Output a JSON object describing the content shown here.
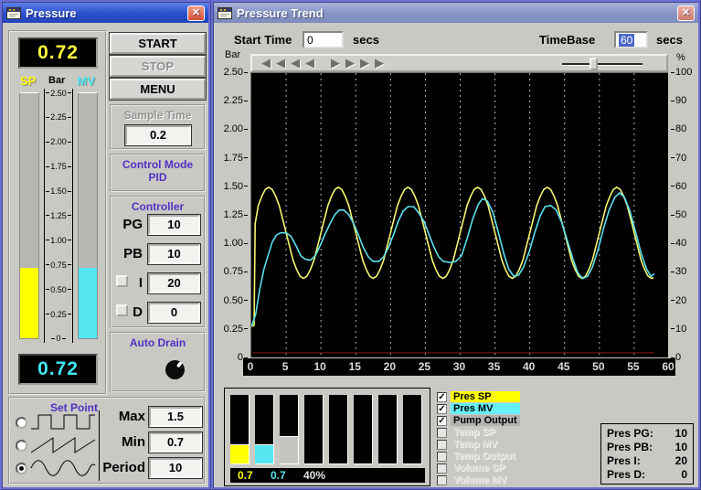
{
  "icons": {
    "check_glyph": "✓",
    "close_glyph": "✕",
    "left_arrow": "◀",
    "right_arrow": "▶"
  },
  "colors": {
    "sp_yellow": "#ffff00",
    "mv_cyan": "#55e6f2",
    "pump_gray": "#c4c4c0",
    "pump_trace": "#7a1414",
    "label_purple": "#5230c4",
    "titlebar_active": "#2a50cc",
    "titlebar_inactive": "#8694c6",
    "chart_bg": "#000000"
  },
  "pressure_window": {
    "title": "Pressure",
    "sp_display": "0.72",
    "mv_display": "0.72",
    "gauge": {
      "sp_label": "SP",
      "unit": "Bar",
      "mv_label": "MV",
      "ticks": [
        "2.50",
        "2.25",
        "2.00",
        "1.75",
        "1.50",
        "1.25",
        "1.00",
        "0.75",
        "0.50",
        "0.25",
        "0"
      ],
      "sp_value": 0.72,
      "mv_value": 0.72,
      "scale_max": 2.5
    },
    "buttons": [
      {
        "label": "START",
        "enabled": true
      },
      {
        "label": "STOP",
        "enabled": false
      },
      {
        "label": "MENU",
        "enabled": true
      }
    ],
    "sample_time": {
      "label": "Sample Time",
      "value": "0.2"
    },
    "control_mode": {
      "line1": "Control Mode",
      "line2": "PID"
    },
    "controller": {
      "title": "Controller",
      "rows": [
        {
          "label": "PG",
          "value": "10",
          "has_checkbox": false,
          "checked": false
        },
        {
          "label": "PB",
          "value": "10",
          "has_checkbox": false,
          "checked": false
        },
        {
          "label": "I",
          "value": "20",
          "has_checkbox": true,
          "checked": false
        },
        {
          "label": "D",
          "value": "0",
          "has_checkbox": true,
          "checked": false
        }
      ]
    },
    "auto_drain": {
      "label": "Auto Drain"
    },
    "set_point": {
      "title": "Set Point",
      "waveforms": [
        "square",
        "sawtooth",
        "sine"
      ],
      "selected_waveform": "sine",
      "rows": [
        {
          "label": "Max",
          "value": "1.5"
        },
        {
          "label": "Min",
          "value": "0.7"
        },
        {
          "label": "Period",
          "value": "10"
        }
      ]
    }
  },
  "trend_window": {
    "title": "Pressure Trend",
    "start_time": {
      "label": "Start Time",
      "value": "0",
      "unit": "secs"
    },
    "timebase": {
      "label": "TimeBase",
      "value": "60",
      "unit": "secs",
      "selected": true
    },
    "axis_units": {
      "left": "Bar",
      "right": "%"
    },
    "legend": [
      {
        "label": "Pres SP",
        "checked": true,
        "enabled": true,
        "color": "#ffff00"
      },
      {
        "label": "Pres MV",
        "checked": true,
        "enabled": true,
        "color": "#66f0f8"
      },
      {
        "label": "Pump Output",
        "checked": true,
        "enabled": true,
        "color": "#b2b2ae"
      },
      {
        "label": "Temp SP",
        "checked": false,
        "enabled": false,
        "color": ""
      },
      {
        "label": "Temp MV",
        "checked": false,
        "enabled": false,
        "color": ""
      },
      {
        "label": "Temp Output",
        "checked": false,
        "enabled": false,
        "color": ""
      },
      {
        "label": "Volume SP",
        "checked": false,
        "enabled": false,
        "color": ""
      },
      {
        "label": "Volume MV",
        "checked": false,
        "enabled": false,
        "color": ""
      }
    ],
    "pid_info": [
      {
        "label": "Pres PG:",
        "value": "10"
      },
      {
        "label": "Pres PB:",
        "value": "10"
      },
      {
        "label": "Pres I:",
        "value": "20"
      },
      {
        "label": "Pres D:",
        "value": "0"
      }
    ],
    "bar_gauges": {
      "count": 8,
      "fills": [
        {
          "fraction": 0.28,
          "color": "#ffff00"
        },
        {
          "fraction": 0.28,
          "color": "#55e6f2"
        },
        {
          "fraction": 0.4,
          "color": "#c4c4c0"
        },
        null,
        null,
        null,
        null,
        null
      ],
      "readout": [
        {
          "text": "0.7",
          "color": "#ffff00"
        },
        {
          "text": "0.7",
          "color": "#55e6f2"
        },
        {
          "text": "40%",
          "color": "#e0e0e0"
        }
      ]
    }
  },
  "chart_data": {
    "type": "line",
    "title": "",
    "xlabel": "secs",
    "xlim": [
      0,
      60
    ],
    "ylim_left": [
      0,
      2.5
    ],
    "ylim_right": [
      0,
      100
    ],
    "x_ticks": [
      0,
      5,
      10,
      15,
      20,
      25,
      30,
      35,
      40,
      45,
      50,
      55,
      60
    ],
    "y_left_ticks": [
      "2.50",
      "2.25",
      "2.00",
      "1.75",
      "1.50",
      "1.25",
      "1.00",
      "0.75",
      "0.50",
      "0.25",
      "0"
    ],
    "y_right_ticks": [
      "100",
      "90",
      "80",
      "70",
      "60",
      "50",
      "40",
      "30",
      "20",
      "10",
      "0"
    ],
    "grid": {
      "vertical_every": 5,
      "style": "dashed",
      "color": "#b4b4b4"
    },
    "legend_position": "below-right",
    "series": [
      {
        "name": "Pres SP",
        "color": "#f6f670",
        "width": 1.6,
        "points": [
          [
            0,
            0.28
          ],
          [
            0.4,
            0.29
          ],
          [
            0.55,
            1.18
          ],
          [
            1,
            1.34
          ],
          [
            1.5,
            1.42
          ],
          [
            2,
            1.48
          ],
          [
            2.5,
            1.5
          ],
          [
            3,
            1.48
          ],
          [
            3.5,
            1.42
          ],
          [
            4,
            1.34
          ],
          [
            4.5,
            1.22
          ],
          [
            5,
            1.1
          ],
          [
            5.5,
            0.98
          ],
          [
            6,
            0.86
          ],
          [
            6.5,
            0.78
          ],
          [
            7,
            0.72
          ],
          [
            7.5,
            0.7
          ],
          [
            8,
            0.72
          ],
          [
            8.5,
            0.78
          ],
          [
            9,
            0.86
          ],
          [
            9.5,
            0.98
          ],
          [
            10,
            1.1
          ],
          [
            10.5,
            1.22
          ],
          [
            11,
            1.34
          ],
          [
            11.5,
            1.42
          ],
          [
            12,
            1.48
          ],
          [
            12.5,
            1.5
          ],
          [
            13,
            1.48
          ],
          [
            13.5,
            1.42
          ],
          [
            14,
            1.34
          ],
          [
            14.5,
            1.22
          ],
          [
            15,
            1.1
          ],
          [
            15.5,
            0.98
          ],
          [
            16,
            0.86
          ],
          [
            16.5,
            0.78
          ],
          [
            17,
            0.72
          ],
          [
            17.5,
            0.7
          ],
          [
            18,
            0.72
          ],
          [
            18.5,
            0.78
          ],
          [
            19,
            0.86
          ],
          [
            19.5,
            0.98
          ],
          [
            20,
            1.1
          ],
          [
            20.5,
            1.22
          ],
          [
            21,
            1.34
          ],
          [
            21.5,
            1.42
          ],
          [
            22,
            1.48
          ],
          [
            22.5,
            1.5
          ],
          [
            23,
            1.48
          ],
          [
            23.5,
            1.42
          ],
          [
            24,
            1.34
          ],
          [
            24.5,
            1.22
          ],
          [
            25,
            1.1
          ],
          [
            25.5,
            0.98
          ],
          [
            26,
            0.86
          ],
          [
            26.5,
            0.78
          ],
          [
            27,
            0.72
          ],
          [
            27.5,
            0.7
          ],
          [
            28,
            0.72
          ],
          [
            28.5,
            0.78
          ],
          [
            29,
            0.86
          ],
          [
            29.5,
            0.98
          ],
          [
            30,
            1.1
          ],
          [
            30.5,
            1.22
          ],
          [
            31,
            1.34
          ],
          [
            31.5,
            1.42
          ],
          [
            32,
            1.48
          ],
          [
            32.5,
            1.5
          ],
          [
            33,
            1.48
          ],
          [
            33.5,
            1.42
          ],
          [
            34,
            1.34
          ],
          [
            34.5,
            1.22
          ],
          [
            35,
            1.1
          ],
          [
            35.5,
            0.98
          ],
          [
            36,
            0.86
          ],
          [
            36.5,
            0.78
          ],
          [
            37,
            0.72
          ],
          [
            37.5,
            0.7
          ],
          [
            38,
            0.72
          ],
          [
            38.5,
            0.78
          ],
          [
            39,
            0.86
          ],
          [
            39.5,
            0.98
          ],
          [
            40,
            1.1
          ],
          [
            40.5,
            1.22
          ],
          [
            41,
            1.34
          ],
          [
            41.5,
            1.42
          ],
          [
            42,
            1.48
          ],
          [
            42.5,
            1.5
          ],
          [
            43,
            1.48
          ],
          [
            43.5,
            1.42
          ],
          [
            44,
            1.34
          ],
          [
            44.5,
            1.22
          ],
          [
            45,
            1.1
          ],
          [
            45.5,
            0.98
          ],
          [
            46,
            0.86
          ],
          [
            46.5,
            0.78
          ],
          [
            47,
            0.72
          ],
          [
            47.5,
            0.7
          ],
          [
            48,
            0.72
          ],
          [
            48.5,
            0.78
          ],
          [
            49,
            0.86
          ],
          [
            49.5,
            0.98
          ],
          [
            50,
            1.1
          ],
          [
            50.5,
            1.22
          ],
          [
            51,
            1.34
          ],
          [
            51.5,
            1.42
          ],
          [
            52,
            1.48
          ],
          [
            52.5,
            1.5
          ],
          [
            53,
            1.48
          ],
          [
            53.5,
            1.42
          ],
          [
            54,
            1.34
          ],
          [
            54.5,
            1.22
          ],
          [
            55,
            1.1
          ],
          [
            55.5,
            0.98
          ],
          [
            56,
            0.86
          ],
          [
            56.5,
            0.78
          ],
          [
            57,
            0.72
          ],
          [
            57.5,
            0.7
          ],
          [
            57.8,
            0.71
          ]
        ]
      },
      {
        "name": "Pres MV",
        "color": "#5ce0ee",
        "width": 1.6,
        "points": [
          [
            0,
            0.28
          ],
          [
            0.6,
            0.38
          ],
          [
            1.2,
            0.6
          ],
          [
            1.8,
            0.78
          ],
          [
            2.4,
            0.9
          ],
          [
            3,
            1.02
          ],
          [
            3.6,
            1.08
          ],
          [
            4.2,
            1.1
          ],
          [
            5,
            1.1
          ],
          [
            5.7,
            1.07
          ],
          [
            6.4,
            0.99
          ],
          [
            7.1,
            0.9
          ],
          [
            7.7,
            0.87
          ],
          [
            8.5,
            0.86
          ],
          [
            9.2,
            0.9
          ],
          [
            9.9,
            0.99
          ],
          [
            10.6,
            1.09
          ],
          [
            11.3,
            1.18
          ],
          [
            12,
            1.26
          ],
          [
            12.6,
            1.3
          ],
          [
            13.3,
            1.3
          ],
          [
            14,
            1.26
          ],
          [
            14.7,
            1.18
          ],
          [
            15.4,
            1.08
          ],
          [
            16.1,
            0.97
          ],
          [
            16.8,
            0.89
          ],
          [
            17.5,
            0.85
          ],
          [
            18.3,
            0.85
          ],
          [
            19,
            0.89
          ],
          [
            19.7,
            0.97
          ],
          [
            20.4,
            1.08
          ],
          [
            21.1,
            1.2
          ],
          [
            21.8,
            1.29
          ],
          [
            22.5,
            1.33
          ],
          [
            23.3,
            1.33
          ],
          [
            24,
            1.28
          ],
          [
            24.8,
            1.2
          ],
          [
            25.5,
            1.09
          ],
          [
            26.2,
            0.98
          ],
          [
            26.9,
            0.89
          ],
          [
            27.6,
            0.85
          ],
          [
            28.6,
            0.84
          ],
          [
            29.4,
            0.85
          ],
          [
            30.2,
            0.9
          ],
          [
            31,
            1.05
          ],
          [
            31.8,
            1.22
          ],
          [
            32.6,
            1.35
          ],
          [
            33.2,
            1.4
          ],
          [
            33.9,
            1.38
          ],
          [
            34.7,
            1.28
          ],
          [
            35.5,
            1.1
          ],
          [
            36.3,
            0.91
          ],
          [
            37,
            0.78
          ],
          [
            37.7,
            0.72
          ],
          [
            38.4,
            0.73
          ],
          [
            39.1,
            0.8
          ],
          [
            39.9,
            0.93
          ],
          [
            40.7,
            1.1
          ],
          [
            41.5,
            1.25
          ],
          [
            42.2,
            1.33
          ],
          [
            43,
            1.34
          ],
          [
            43.8,
            1.3
          ],
          [
            44.6,
            1.19
          ],
          [
            45.4,
            1.03
          ],
          [
            46.2,
            0.87
          ],
          [
            46.9,
            0.75
          ],
          [
            47.6,
            0.7
          ],
          [
            48.3,
            0.72
          ],
          [
            49,
            0.8
          ],
          [
            49.8,
            0.95
          ],
          [
            50.6,
            1.14
          ],
          [
            51.4,
            1.3
          ],
          [
            52.2,
            1.41
          ],
          [
            52.9,
            1.45
          ],
          [
            53.6,
            1.41
          ],
          [
            54.4,
            1.29
          ],
          [
            55.2,
            1.11
          ],
          [
            56,
            0.92
          ],
          [
            56.8,
            0.78
          ],
          [
            57.4,
            0.72
          ],
          [
            57.9,
            0.74
          ]
        ]
      },
      {
        "name": "Pump Output",
        "color": "#7a1414",
        "width": 1.2,
        "points": [
          [
            0.2,
            0.05
          ],
          [
            57.9,
            0.05
          ]
        ]
      }
    ]
  }
}
